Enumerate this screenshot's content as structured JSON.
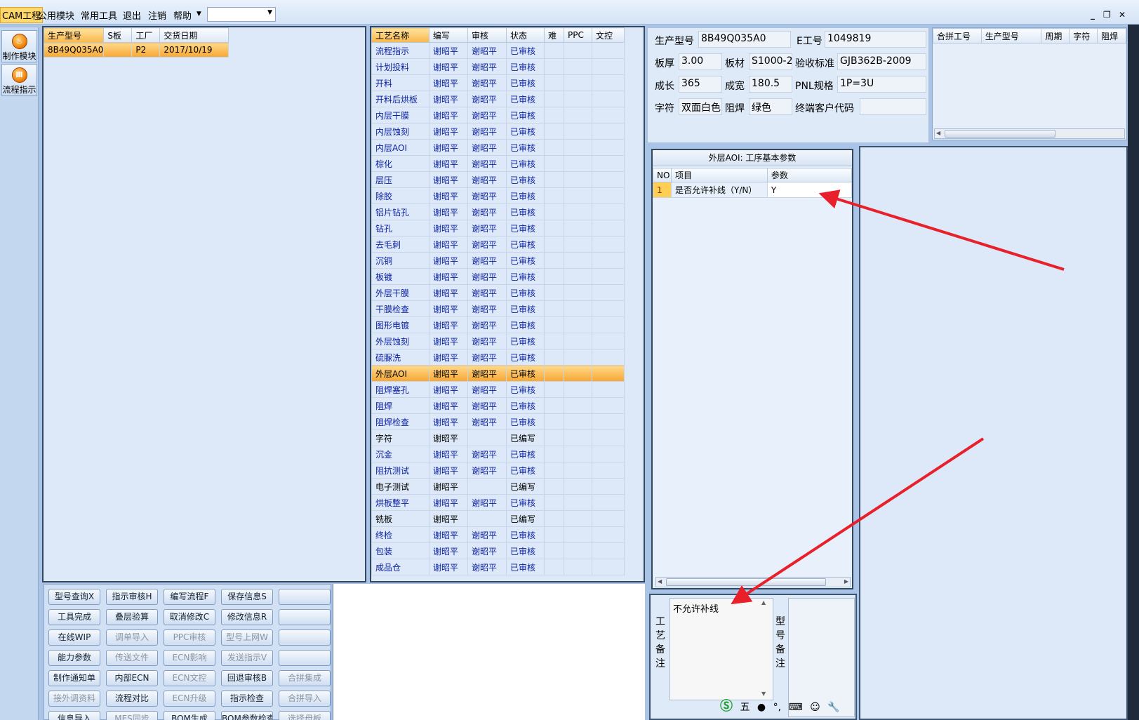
{
  "menu": {
    "items": [
      "CAM工程",
      "公用模块",
      "常用工具",
      "退出",
      "注销",
      "帮助"
    ],
    "dropdown_value": "",
    "window_min": "_",
    "window_restore": "❐",
    "window_close": "✕"
  },
  "sidebar": [
    {
      "label": "制作模块",
      "icon": "fire-icon"
    },
    {
      "label": "流程指示",
      "icon": "flow-icon"
    }
  ],
  "model_list": {
    "columns": [
      "生产型号",
      "S板",
      "工厂",
      "交货日期"
    ],
    "rows": [
      {
        "model": "8B49Q035A0",
        "s": "",
        "factory": "P2",
        "date": "2017/10/19"
      }
    ]
  },
  "process_table": {
    "columns": [
      "工艺名称",
      "编写",
      "审核",
      "状态",
      "难",
      "PPC",
      "文控"
    ],
    "selected": "外层AOI",
    "rows": [
      {
        "name": "流程指示",
        "writer": "谢昭平",
        "reviewer": "谢昭平",
        "status": "已审核"
      },
      {
        "name": "计划投料",
        "writer": "谢昭平",
        "reviewer": "谢昭平",
        "status": "已审核"
      },
      {
        "name": "开料",
        "writer": "谢昭平",
        "reviewer": "谢昭平",
        "status": "已审核"
      },
      {
        "name": "开料后烘板",
        "writer": "谢昭平",
        "reviewer": "谢昭平",
        "status": "已审核"
      },
      {
        "name": "内层干膜",
        "writer": "谢昭平",
        "reviewer": "谢昭平",
        "status": "已审核"
      },
      {
        "name": "内层蚀刻",
        "writer": "谢昭平",
        "reviewer": "谢昭平",
        "status": "已审核"
      },
      {
        "name": "内层AOI",
        "writer": "谢昭平",
        "reviewer": "谢昭平",
        "status": "已审核"
      },
      {
        "name": "棕化",
        "writer": "谢昭平",
        "reviewer": "谢昭平",
        "status": "已审核"
      },
      {
        "name": "层压",
        "writer": "谢昭平",
        "reviewer": "谢昭平",
        "status": "已审核"
      },
      {
        "name": "除胶",
        "writer": "谢昭平",
        "reviewer": "谢昭平",
        "status": "已审核"
      },
      {
        "name": "铝片钻孔",
        "writer": "谢昭平",
        "reviewer": "谢昭平",
        "status": "已审核"
      },
      {
        "name": "钻孔",
        "writer": "谢昭平",
        "reviewer": "谢昭平",
        "status": "已审核"
      },
      {
        "name": "去毛刺",
        "writer": "谢昭平",
        "reviewer": "谢昭平",
        "status": "已审核"
      },
      {
        "name": "沉铜",
        "writer": "谢昭平",
        "reviewer": "谢昭平",
        "status": "已审核"
      },
      {
        "name": "板镀",
        "writer": "谢昭平",
        "reviewer": "谢昭平",
        "status": "已审核"
      },
      {
        "name": "外层干膜",
        "writer": "谢昭平",
        "reviewer": "谢昭平",
        "status": "已审核"
      },
      {
        "name": "干膜检查",
        "writer": "谢昭平",
        "reviewer": "谢昭平",
        "status": "已审核"
      },
      {
        "name": "图形电镀",
        "writer": "谢昭平",
        "reviewer": "谢昭平",
        "status": "已审核"
      },
      {
        "name": "外层蚀刻",
        "writer": "谢昭平",
        "reviewer": "谢昭平",
        "status": "已审核"
      },
      {
        "name": "硫脲洗",
        "writer": "谢昭平",
        "reviewer": "谢昭平",
        "status": "已审核"
      },
      {
        "name": "外层AOI",
        "writer": "谢昭平",
        "reviewer": "谢昭平",
        "status": "已审核"
      },
      {
        "name": "阻焊塞孔",
        "writer": "谢昭平",
        "reviewer": "谢昭平",
        "status": "已审核"
      },
      {
        "name": "阻焊",
        "writer": "谢昭平",
        "reviewer": "谢昭平",
        "status": "已审核"
      },
      {
        "name": "阻焊检查",
        "writer": "谢昭平",
        "reviewer": "谢昭平",
        "status": "已审核"
      },
      {
        "name": "字符",
        "writer": "谢昭平",
        "reviewer": "",
        "status": "已编写"
      },
      {
        "name": "沉金",
        "writer": "谢昭平",
        "reviewer": "谢昭平",
        "status": "已审核"
      },
      {
        "name": "阻抗测试",
        "writer": "谢昭平",
        "reviewer": "谢昭平",
        "status": "已审核"
      },
      {
        "name": "电子测试",
        "writer": "谢昭平",
        "reviewer": "",
        "status": "已编写"
      },
      {
        "name": "烘板整平",
        "writer": "谢昭平",
        "reviewer": "谢昭平",
        "status": "已审核"
      },
      {
        "name": "铣板",
        "writer": "谢昭平",
        "reviewer": "",
        "status": "已编写"
      },
      {
        "name": "终检",
        "writer": "谢昭平",
        "reviewer": "谢昭平",
        "status": "已审核"
      },
      {
        "name": "包装",
        "writer": "谢昭平",
        "reviewer": "谢昭平",
        "status": "已审核"
      },
      {
        "name": "成品仓",
        "writer": "谢昭平",
        "reviewer": "谢昭平",
        "status": "已审核"
      }
    ]
  },
  "info": {
    "model_label": "生产型号",
    "model": "8B49Q035A0",
    "eno_label": "E工号",
    "eno": "1049819",
    "thick_label": "板厚",
    "thick": "3.00",
    "material_label": "板材",
    "material": "S1000-2",
    "standard_label": "验收标准",
    "standard": "GJB362B-2009",
    "length_label": "成长",
    "length": "365",
    "width_label": "成宽",
    "width": "180.5",
    "pnl_label": "PNL规格",
    "pnl": "1P=3U",
    "char_label": "字符",
    "char": "双面白色",
    "mask_label": "阻焊",
    "mask": "绿色",
    "client_label": "终端客户代码",
    "client": ""
  },
  "merge_table": {
    "columns": [
      "合拼工号",
      "生产型号",
      "周期",
      "字符",
      "阻焊"
    ]
  },
  "params": {
    "title": "外层AOI: 工序基本参数",
    "columns": [
      "NO",
      "项目",
      "参数"
    ],
    "rows": [
      {
        "no": "1",
        "item": "是否允许补线（Y/N）",
        "value": "Y"
      }
    ]
  },
  "remarks": {
    "process_label": "工艺备注",
    "process_text": "不允许补线",
    "model_label": "型号备注",
    "model_text": ""
  },
  "ime": {
    "label": "五"
  },
  "buttons": [
    [
      "型号查询X",
      "指示审核H",
      "编写流程F",
      "保存信息S",
      ""
    ],
    [
      "工具完成",
      "叠层验算",
      "取消修改C",
      "修改信息R",
      ""
    ],
    [
      "在线WIP",
      "调单导入",
      "PPC审核",
      "型号上网W",
      ""
    ],
    [
      "能力参数",
      "传送文件",
      "ECN影响",
      "发送指示V",
      ""
    ],
    [
      "制作通知单",
      "内部ECN",
      "ECN文控",
      "回退审核B",
      "合拼集成"
    ],
    [
      "接外调资料",
      "流程对比",
      "ECN升级",
      "指示检查",
      "合拼导入"
    ],
    [
      "信息导入",
      "MES同步",
      "BOM生成",
      "BOM参数检查",
      "选择母板"
    ]
  ],
  "buttons_disabled": [
    [
      false,
      false,
      false,
      false,
      false
    ],
    [
      false,
      false,
      false,
      false,
      false
    ],
    [
      false,
      true,
      true,
      true,
      false
    ],
    [
      false,
      true,
      true,
      true,
      false
    ],
    [
      false,
      false,
      true,
      false,
      true
    ],
    [
      true,
      false,
      true,
      false,
      true
    ],
    [
      false,
      true,
      false,
      false,
      true
    ]
  ],
  "colors": {
    "accent": "#f8b84a",
    "panel_border": "#33475f",
    "link_text": "#0a1fa0",
    "annotation_arrow": "#e8202a"
  }
}
